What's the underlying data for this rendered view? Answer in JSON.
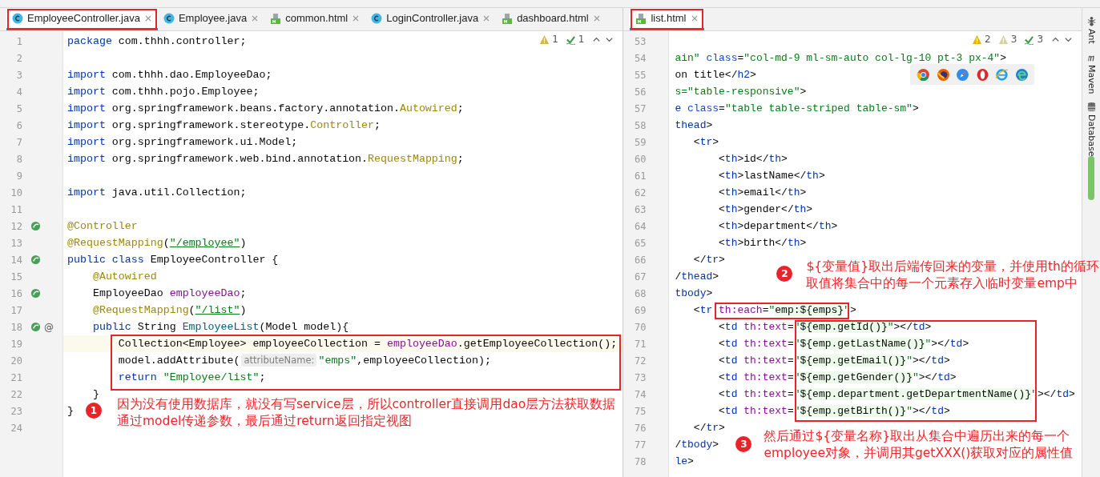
{
  "left_editor": {
    "tabs": [
      {
        "label": "EmployeeController.java",
        "kind": "java",
        "selected": true
      },
      {
        "label": "Employee.java",
        "kind": "java",
        "selected": false
      },
      {
        "label": "common.html",
        "kind": "html",
        "selected": false
      },
      {
        "label": "LoginController.java",
        "kind": "java",
        "selected": false
      },
      {
        "label": "dashboard.html",
        "kind": "html",
        "selected": false
      }
    ],
    "inspections": [
      {
        "kind": "warning",
        "count": "1"
      },
      {
        "kind": "typo",
        "count": "1"
      }
    ],
    "lines": [
      {
        "number": "1",
        "current": false,
        "tokens": [
          {
            "kind": "kw",
            "text": "package"
          },
          {
            "kind": "plain",
            "text": " com.thhh.controller;"
          }
        ]
      },
      {
        "number": "2",
        "current": false
      },
      {
        "number": "3",
        "current": false,
        "tokens": [
          {
            "kind": "kw",
            "text": "import"
          },
          {
            "kind": "plain",
            "text": " com.thhh.dao.EmployeeDao;"
          }
        ]
      },
      {
        "number": "4",
        "current": false,
        "tokens": [
          {
            "kind": "kw",
            "text": "import"
          },
          {
            "kind": "plain",
            "text": " com.thhh.pojo.Employee;"
          }
        ]
      },
      {
        "number": "5",
        "current": false,
        "tokens": [
          {
            "kind": "kw",
            "text": "import"
          },
          {
            "kind": "plain",
            "text": " org.springframework.beans.factory.annotation."
          },
          {
            "kind": "ann",
            "text": "Autowired"
          },
          {
            "kind": "plain",
            "text": ";"
          }
        ]
      },
      {
        "number": "6",
        "current": false,
        "tokens": [
          {
            "kind": "kw",
            "text": "import"
          },
          {
            "kind": "plain",
            "text": " org.springframework.stereotype."
          },
          {
            "kind": "ann",
            "text": "Controller"
          },
          {
            "kind": "plain",
            "text": ";"
          }
        ]
      },
      {
        "number": "7",
        "current": false,
        "tokens": [
          {
            "kind": "kw",
            "text": "import"
          },
          {
            "kind": "plain",
            "text": " org.springframework.ui.Model;"
          }
        ]
      },
      {
        "number": "8",
        "current": false,
        "tokens": [
          {
            "kind": "kw",
            "text": "import"
          },
          {
            "kind": "plain",
            "text": " org.springframework.web.bind.annotation."
          },
          {
            "kind": "ann",
            "text": "RequestMapping"
          },
          {
            "kind": "plain",
            "text": ";"
          }
        ]
      },
      {
        "number": "9",
        "current": false
      },
      {
        "number": "10",
        "current": false,
        "tokens": [
          {
            "kind": "kw",
            "text": "import"
          },
          {
            "kind": "plain",
            "text": " java.util.Collection;"
          }
        ]
      },
      {
        "number": "11",
        "current": false
      },
      {
        "number": "12",
        "current": false,
        "gutter": {
          "kind": "bean"
        },
        "tokens": [
          {
            "kind": "ann",
            "text": "@Controller"
          }
        ]
      },
      {
        "number": "13",
        "current": false,
        "tokens": [
          {
            "kind": "ann",
            "text": "@RequestMapping"
          },
          {
            "kind": "plain",
            "text": "("
          },
          {
            "kind": "link",
            "text": "\"/employee\""
          },
          {
            "kind": "plain",
            "text": ")"
          }
        ]
      },
      {
        "number": "14",
        "current": false,
        "gutter": {
          "kind": "bean"
        },
        "tokens": [
          {
            "kind": "kw",
            "text": "public class"
          },
          {
            "kind": "plain",
            "text": " EmployeeController {"
          }
        ]
      },
      {
        "number": "15",
        "current": false,
        "tokens": [
          {
            "kind": "ann",
            "text": "    @Autowired"
          }
        ]
      },
      {
        "number": "16",
        "current": false,
        "gutter": {
          "kind": "bean"
        },
        "tokens": [
          {
            "kind": "plain",
            "text": "    EmployeeDao "
          },
          {
            "kind": "field",
            "text": "employeeDao"
          },
          {
            "kind": "plain",
            "text": ";"
          }
        ]
      },
      {
        "number": "17",
        "current": false,
        "tokens": [
          {
            "kind": "ann",
            "text": "    @RequestMapping"
          },
          {
            "kind": "plain",
            "text": "("
          },
          {
            "kind": "link",
            "text": "\"/list\""
          },
          {
            "kind": "plain",
            "text": ")"
          }
        ]
      },
      {
        "number": "18",
        "current": false,
        "gutter": {
          "kind": "bean",
          "symbol": "@"
        },
        "tokens": [
          {
            "kind": "kw",
            "text": "    public"
          },
          {
            "kind": "plain",
            "text": " String "
          },
          {
            "kind": "method",
            "text": "EmployeeList"
          },
          {
            "kind": "plain",
            "text": "(Model model){"
          }
        ]
      },
      {
        "number": "19",
        "current": true,
        "tokens": [
          {
            "kind": "plain",
            "text": "        Collection<Employee> employeeCollection = "
          },
          {
            "kind": "field",
            "text": "employeeDao"
          },
          {
            "kind": "plain",
            "text": ".getEmployeeCollection();"
          }
        ]
      },
      {
        "number": "20",
        "current": false,
        "tokens": [
          {
            "kind": "plain",
            "text": "        model.addAttribute("
          },
          {
            "kind": "hint",
            "text": "attributeName:"
          },
          {
            "kind": "str",
            "text": "\"emps\""
          },
          {
            "kind": "plain",
            "text": ",employeeCollection);"
          }
        ]
      },
      {
        "number": "21",
        "current": false,
        "tokens": [
          {
            "kind": "kw",
            "text": "        return"
          },
          {
            "kind": "str",
            "text": " \"Employee/list\""
          },
          {
            "kind": "plain",
            "text": ";"
          }
        ]
      },
      {
        "number": "22",
        "current": false,
        "tokens": [
          {
            "kind": "plain",
            "text": "    }"
          }
        ]
      },
      {
        "number": "23",
        "current": false,
        "tokens": [
          {
            "kind": "plain",
            "text": "}"
          }
        ]
      },
      {
        "number": "24",
        "current": false
      }
    ],
    "annotations": [
      {
        "number": "1",
        "lines": [
          "因为没有使用数据库，就没有写service层，所以controller直接调用dao层方法获取数据",
          "通过model传递参数，最后通过return返回指定视图"
        ]
      }
    ]
  },
  "right_editor": {
    "tabs": [
      {
        "label": "list.html",
        "kind": "html",
        "selected": true
      }
    ],
    "inspections": [
      {
        "kind": "warning",
        "count": "2"
      },
      {
        "kind": "weak",
        "count": "3"
      },
      {
        "kind": "typo",
        "count": "3"
      }
    ],
    "lines": [
      {
        "number": "53"
      },
      {
        "number": "54",
        "tokens": [
          {
            "kind": "str",
            "text": "ain\""
          },
          {
            "kind": "attr",
            "text": " class"
          },
          {
            "kind": "plain",
            "text": "="
          },
          {
            "kind": "str",
            "text": "\"col-md-9 ml-sm-auto col-lg-10 pt-3 px-4\""
          },
          {
            "kind": "plain",
            "text": ">"
          }
        ]
      },
      {
        "number": "55",
        "tokens": [
          {
            "kind": "plain",
            "text": "on title</"
          },
          {
            "kind": "tag",
            "text": "h2"
          },
          {
            "kind": "plain",
            "text": ">"
          }
        ]
      },
      {
        "number": "56",
        "tokens": [
          {
            "kind": "str",
            "text": "s=\"table-responsive\""
          },
          {
            "kind": "plain",
            "text": ">"
          }
        ]
      },
      {
        "number": "57",
        "tokens": [
          {
            "kind": "tag",
            "text": "e"
          },
          {
            "kind": "attr",
            "text": " class"
          },
          {
            "kind": "plain",
            "text": "="
          },
          {
            "kind": "str",
            "text": "\"table table-striped table-sm\""
          },
          {
            "kind": "plain",
            "text": ">"
          }
        ]
      },
      {
        "number": "58",
        "tokens": [
          {
            "kind": "tag",
            "text": "thead"
          },
          {
            "kind": "plain",
            "text": ">"
          }
        ]
      },
      {
        "number": "59",
        "tokens": [
          {
            "kind": "plain",
            "text": "   <"
          },
          {
            "kind": "tag",
            "text": "tr"
          },
          {
            "kind": "plain",
            "text": ">"
          }
        ]
      },
      {
        "number": "60",
        "tokens": [
          {
            "kind": "plain",
            "text": "       <"
          },
          {
            "kind": "tag",
            "text": "th"
          },
          {
            "kind": "plain",
            "text": ">id</"
          },
          {
            "kind": "tag",
            "text": "th"
          },
          {
            "kind": "plain",
            "text": ">"
          }
        ]
      },
      {
        "number": "61",
        "tokens": [
          {
            "kind": "plain",
            "text": "       <"
          },
          {
            "kind": "tag",
            "text": "th"
          },
          {
            "kind": "plain",
            "text": ">lastName</"
          },
          {
            "kind": "tag",
            "text": "th"
          },
          {
            "kind": "plain",
            "text": ">"
          }
        ]
      },
      {
        "number": "62",
        "tokens": [
          {
            "kind": "plain",
            "text": "       <"
          },
          {
            "kind": "tag",
            "text": "th"
          },
          {
            "kind": "plain",
            "text": ">email</"
          },
          {
            "kind": "tag",
            "text": "th"
          },
          {
            "kind": "plain",
            "text": ">"
          }
        ]
      },
      {
        "number": "63",
        "tokens": [
          {
            "kind": "plain",
            "text": "       <"
          },
          {
            "kind": "tag",
            "text": "th"
          },
          {
            "kind": "plain",
            "text": ">gender</"
          },
          {
            "kind": "tag",
            "text": "th"
          },
          {
            "kind": "plain",
            "text": ">"
          }
        ]
      },
      {
        "number": "64",
        "tokens": [
          {
            "kind": "plain",
            "text": "       <"
          },
          {
            "kind": "tag",
            "text": "th"
          },
          {
            "kind": "plain",
            "text": ">department</"
          },
          {
            "kind": "tag",
            "text": "th"
          },
          {
            "kind": "plain",
            "text": ">"
          }
        ]
      },
      {
        "number": "65",
        "tokens": [
          {
            "kind": "plain",
            "text": "       <"
          },
          {
            "kind": "tag",
            "text": "th"
          },
          {
            "kind": "plain",
            "text": ">birth</"
          },
          {
            "kind": "tag",
            "text": "th"
          },
          {
            "kind": "plain",
            "text": ">"
          }
        ]
      },
      {
        "number": "66",
        "tokens": [
          {
            "kind": "plain",
            "text": "   </"
          },
          {
            "kind": "tag",
            "text": "tr"
          },
          {
            "kind": "plain",
            "text": ">"
          }
        ]
      },
      {
        "number": "67",
        "tokens": [
          {
            "kind": "plain",
            "text": "/"
          },
          {
            "kind": "tag",
            "text": "thead"
          },
          {
            "kind": "plain",
            "text": ">"
          }
        ]
      },
      {
        "number": "68",
        "tokens": [
          {
            "kind": "tag",
            "text": "tbody"
          },
          {
            "kind": "plain",
            "text": ">"
          }
        ]
      },
      {
        "number": "69",
        "tokens": [
          {
            "kind": "plain",
            "text": "   <"
          },
          {
            "kind": "tag",
            "text": "tr"
          },
          {
            "kind": "thattr",
            "text": " th:each"
          },
          {
            "kind": "plain",
            "text": "="
          },
          {
            "kind": "str",
            "text": "\""
          },
          {
            "kind": "expr",
            "text": "emp:${emps}"
          },
          {
            "kind": "str",
            "text": "\""
          },
          {
            "kind": "plain",
            "text": ">"
          }
        ]
      },
      {
        "number": "70",
        "tokens": [
          {
            "kind": "plain",
            "text": "       <"
          },
          {
            "kind": "tag",
            "text": "td"
          },
          {
            "kind": "thattr",
            "text": " th:text"
          },
          {
            "kind": "plain",
            "text": "="
          },
          {
            "kind": "str",
            "text": "\""
          },
          {
            "kind": "expr",
            "text": "${emp.getId()}"
          },
          {
            "kind": "str",
            "text": "\""
          },
          {
            "kind": "plain",
            "text": "></"
          },
          {
            "kind": "tag",
            "text": "td"
          },
          {
            "kind": "plain",
            "text": ">"
          }
        ]
      },
      {
        "number": "71",
        "tokens": [
          {
            "kind": "plain",
            "text": "       <"
          },
          {
            "kind": "tag",
            "text": "td"
          },
          {
            "kind": "thattr",
            "text": " th:text"
          },
          {
            "kind": "plain",
            "text": "="
          },
          {
            "kind": "str",
            "text": "\""
          },
          {
            "kind": "expr",
            "text": "${emp.getLastName()}"
          },
          {
            "kind": "str",
            "text": "\""
          },
          {
            "kind": "plain",
            "text": "></"
          },
          {
            "kind": "tag",
            "text": "td"
          },
          {
            "kind": "plain",
            "text": ">"
          }
        ]
      },
      {
        "number": "72",
        "tokens": [
          {
            "kind": "plain",
            "text": "       <"
          },
          {
            "kind": "tag",
            "text": "td"
          },
          {
            "kind": "thattr",
            "text": " th:text"
          },
          {
            "kind": "plain",
            "text": "="
          },
          {
            "kind": "str",
            "text": "\""
          },
          {
            "kind": "expr",
            "text": "${emp.getEmail()}"
          },
          {
            "kind": "str",
            "text": "\""
          },
          {
            "kind": "plain",
            "text": "></"
          },
          {
            "kind": "tag",
            "text": "td"
          },
          {
            "kind": "plain",
            "text": ">"
          }
        ]
      },
      {
        "number": "73",
        "tokens": [
          {
            "kind": "plain",
            "text": "       <"
          },
          {
            "kind": "tag",
            "text": "td"
          },
          {
            "kind": "thattr",
            "text": " th:text"
          },
          {
            "kind": "plain",
            "text": "="
          },
          {
            "kind": "str",
            "text": "\""
          },
          {
            "kind": "expr",
            "text": "${emp.getGender()}"
          },
          {
            "kind": "str",
            "text": "\""
          },
          {
            "kind": "plain",
            "text": "></"
          },
          {
            "kind": "tag",
            "text": "td"
          },
          {
            "kind": "plain",
            "text": ">"
          }
        ]
      },
      {
        "number": "74",
        "tokens": [
          {
            "kind": "plain",
            "text": "       <"
          },
          {
            "kind": "tag",
            "text": "td"
          },
          {
            "kind": "thattr",
            "text": " th:text"
          },
          {
            "kind": "plain",
            "text": "="
          },
          {
            "kind": "str",
            "text": "\""
          },
          {
            "kind": "expr",
            "text": "${emp.department.getDepartmentName()}"
          },
          {
            "kind": "str",
            "text": "\""
          },
          {
            "kind": "plain",
            "text": "></"
          },
          {
            "kind": "tag",
            "text": "td"
          },
          {
            "kind": "plain",
            "text": ">"
          }
        ]
      },
      {
        "number": "75",
        "tokens": [
          {
            "kind": "plain",
            "text": "       <"
          },
          {
            "kind": "tag",
            "text": "td"
          },
          {
            "kind": "thattr",
            "text": " th:text"
          },
          {
            "kind": "plain",
            "text": "="
          },
          {
            "kind": "str",
            "text": "\""
          },
          {
            "kind": "expr",
            "text": "${emp.getBirth()}"
          },
          {
            "kind": "str",
            "text": "\""
          },
          {
            "kind": "plain",
            "text": "></"
          },
          {
            "kind": "tag",
            "text": "td"
          },
          {
            "kind": "plain",
            "text": ">"
          }
        ]
      },
      {
        "number": "76",
        "tokens": [
          {
            "kind": "plain",
            "text": "   </"
          },
          {
            "kind": "tag",
            "text": "tr"
          },
          {
            "kind": "plain",
            "text": ">"
          }
        ]
      },
      {
        "number": "77",
        "tokens": [
          {
            "kind": "plain",
            "text": "/"
          },
          {
            "kind": "tag",
            "text": "tbody"
          },
          {
            "kind": "plain",
            "text": ">"
          }
        ]
      },
      {
        "number": "78",
        "tokens": [
          {
            "kind": "tag",
            "text": "le"
          },
          {
            "kind": "plain",
            "text": ">"
          }
        ]
      }
    ],
    "annotations": [
      {
        "number": "2",
        "lines": [
          "${变量值}取出后端传回来的变量，并使用th的循环",
          "取值将集合中的每一个元素存入临时变量emp中"
        ]
      },
      {
        "number": "3",
        "lines": [
          "然后通过${变量名称}取出从集合中遍历出来的每一个",
          "employee对象，并调用其getXXX()获取对应的属性值"
        ]
      }
    ]
  },
  "tool_strip": [
    {
      "label": "Ant",
      "kind": "ant"
    },
    {
      "label": "Maven",
      "kind": "maven"
    },
    {
      "label": "Database",
      "kind": "database"
    }
  ]
}
